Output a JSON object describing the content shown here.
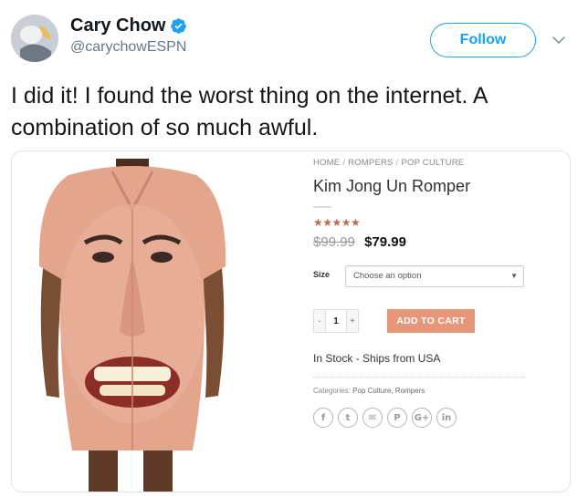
{
  "tweet": {
    "display_name": "Cary Chow",
    "handle": "@carychowESPN",
    "follow_label": "Follow",
    "text": "I did it! I found the worst thing on the internet. A combination of so much awful."
  },
  "product": {
    "breadcrumb": [
      "HOME",
      "ROMPERS",
      "POP CULTURE"
    ],
    "breadcrumb_separator": "/",
    "title": "Kim Jong Un Romper",
    "stars": "★★★★★",
    "old_price": "$99.99",
    "new_price": "$79.99",
    "size_label": "Size",
    "size_select_value": "Choose an option",
    "quantity_minus": "-",
    "quantity_value": "1",
    "quantity_plus": "+",
    "add_to_cart_label": "ADD TO CART",
    "stock_text": "In Stock - Ships from USA",
    "categories_label": "Categories:",
    "categories": "Pop Culture, Rompers",
    "share_icons": [
      {
        "name": "facebook-icon",
        "glyph": "f"
      },
      {
        "name": "twitter-icon",
        "glyph": "t"
      },
      {
        "name": "email-icon",
        "glyph": "✉"
      },
      {
        "name": "pinterest-icon",
        "glyph": "P"
      },
      {
        "name": "google-plus-icon",
        "glyph": "G+"
      },
      {
        "name": "linkedin-icon",
        "glyph": "in"
      }
    ]
  },
  "colors": {
    "twitter_blue": "#1da1f2",
    "verified_blue": "#1da1f2",
    "add_to_cart_bg": "#e8967a",
    "star_color": "#c06a4e"
  }
}
